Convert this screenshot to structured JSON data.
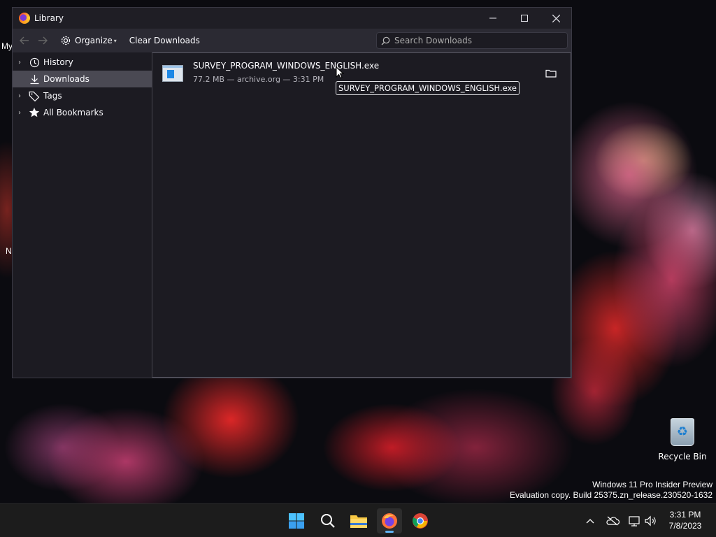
{
  "window": {
    "title": "Library",
    "minimize_label": "—",
    "maximize_label": "☐",
    "close_label": "✕"
  },
  "toolbar": {
    "organize_label": "Organize",
    "clear_downloads_label": "Clear Downloads",
    "search_placeholder": "Search Downloads"
  },
  "sidebar": {
    "items": [
      {
        "label": "History",
        "icon": "clock-icon",
        "expandable": true
      },
      {
        "label": "Downloads",
        "icon": "download-icon",
        "expandable": false,
        "selected": true
      },
      {
        "label": "Tags",
        "icon": "tag-icon",
        "expandable": true
      },
      {
        "label": "All Bookmarks",
        "icon": "star-icon",
        "expandable": true
      }
    ]
  },
  "downloads": [
    {
      "file_name": "SURVEY_PROGRAM_WINDOWS_ENGLISH.exe",
      "meta": "77.2 MB — archive.org — 3:31 PM"
    }
  ],
  "tooltip": "SURVEY_PROGRAM_WINDOWS_ENGLISH.exe",
  "desktop": {
    "partial_labels": [
      "My",
      "N"
    ],
    "recycle_bin_label": "Recycle Bin",
    "watermark_line1": "Windows 11 Pro Insider Preview",
    "watermark_line2": "Evaluation copy. Build 25375.zn_release.230520-1632"
  },
  "taskbar": {
    "apps": [
      "start-icon",
      "search-icon",
      "file-explorer-icon",
      "firefox-icon",
      "chrome-icon"
    ],
    "time": "3:31 PM",
    "date": "7/8/2023"
  },
  "colors": {
    "window_bg": "#1c1b22",
    "toolbar_bg": "#2b2a33",
    "selected_bg": "#4a4953",
    "accent": "#5fb2f2"
  }
}
